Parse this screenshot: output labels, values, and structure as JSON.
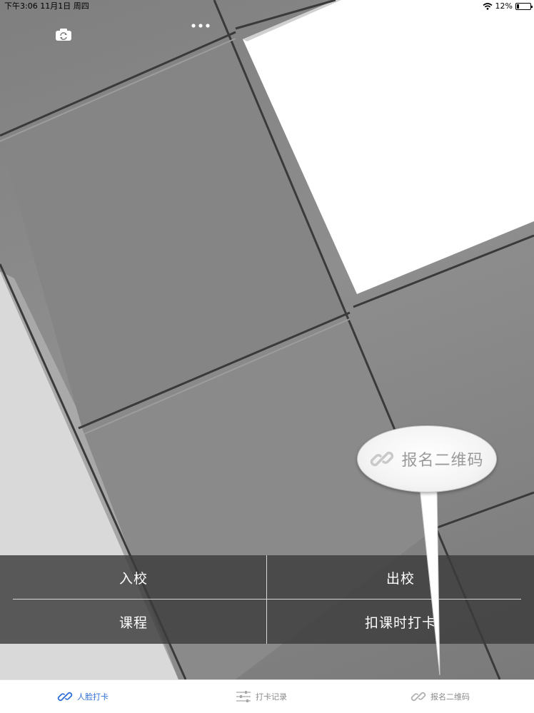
{
  "status_bar": {
    "time_date": "下午3:06   11月1日 周四",
    "battery": "12%"
  },
  "top_controls": {
    "switch_camera_icon": "camera-rotate-icon",
    "more_icon": "ellipsis-icon"
  },
  "actions": [
    {
      "label": "入校"
    },
    {
      "label": "出校"
    },
    {
      "label": "课程"
    },
    {
      "label": "扣课时打卡"
    }
  ],
  "callout": {
    "label": "报名二维码",
    "icon": "link-icon"
  },
  "tabs": [
    {
      "label": "人脸打卡",
      "icon": "link-icon",
      "active": true
    },
    {
      "label": "打卡记录",
      "icon": "sliders-icon",
      "active": false
    },
    {
      "label": "报名二维码",
      "icon": "link-icon",
      "active": false
    }
  ],
  "colors": {
    "accent": "#2f6fd8",
    "tab_inactive": "#8a8a8a"
  }
}
